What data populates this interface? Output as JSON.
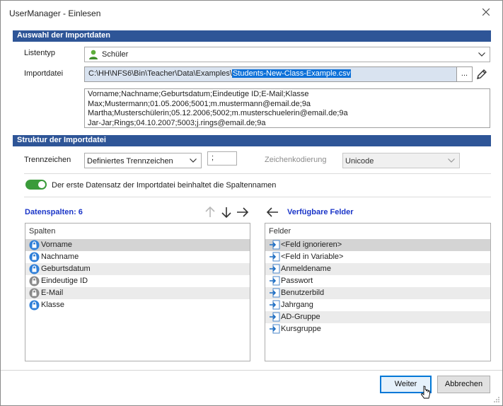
{
  "window": {
    "title": "UserManager - Einlesen"
  },
  "sections": {
    "import_data": "Auswahl der Importdaten",
    "structure": "Struktur der Importdatei"
  },
  "listtype": {
    "label": "Listentyp",
    "value": "Schüler",
    "icon": "user-green-icon"
  },
  "importfile": {
    "label": "Importdatei",
    "path_prefix": "C:\\HH\\NFS6\\Bin\\Teacher\\Data\\Examples\\",
    "path_selected": "Students-New-Class-Example.csv",
    "browse_label": "...",
    "edit_icon": "pencil-icon"
  },
  "preview_lines": [
    "Vorname;Nachname;Geburtsdatum;Eindeutige ID;E-Mail;Klasse",
    "Max;Mustermann;01.05.2006;5001;m.mustermann@email.de;9a",
    "Martha;Musterschülerin;05.12.2006;5002;m.musterschuelerin@email.de;9a",
    "Jar-Jar;Rings;04.10.2007;5003;j.rings@email.de;9a"
  ],
  "separator": {
    "label": "Trennzeichen",
    "value": "Definiertes Trennzeichen",
    "char": ";"
  },
  "encoding": {
    "label": "Zeichenkodierung",
    "value": "Unicode"
  },
  "header_toggle": {
    "label": "Der erste Datensatz der Importdatei beinhaltet die Spaltennamen",
    "on": true
  },
  "columns_pane": {
    "title": "Datenspalten: 6",
    "header": "Spalten",
    "items": [
      {
        "label": "Vorname",
        "icon": "lock-blue-icon"
      },
      {
        "label": "Nachname",
        "icon": "lock-blue-icon"
      },
      {
        "label": "Geburtsdatum",
        "icon": "lock-blue-icon"
      },
      {
        "label": "Eindeutige ID",
        "icon": "lock-grey-icon"
      },
      {
        "label": "E-Mail",
        "icon": "lock-grey-icon"
      },
      {
        "label": "Klasse",
        "icon": "lock-blue-icon"
      }
    ]
  },
  "fields_pane": {
    "title": "Verfügbare Felder",
    "header": "Felder",
    "items": [
      "<Feld ignorieren>",
      "<Feld in Variable>",
      "Anmeldename",
      "Passwort",
      "Benutzerbild",
      "Jahrgang",
      "AD-Gruppe",
      "Kursgruppe"
    ]
  },
  "buttons": {
    "next": "Weiter",
    "cancel": "Abbrechen"
  },
  "colors": {
    "section": "#2e5597",
    "accent": "#1a35c8",
    "toggle": "#3a9b3a",
    "selection": "#0c70d8"
  }
}
